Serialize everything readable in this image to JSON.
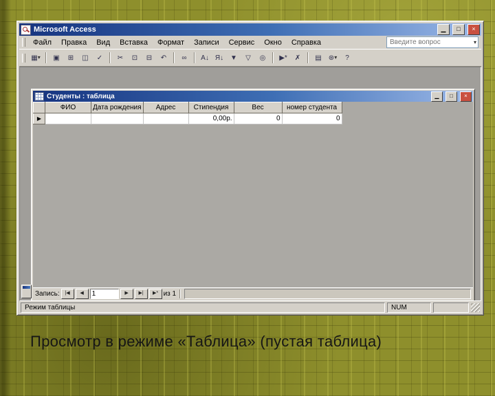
{
  "slide": {
    "caption": "Просмотр в режиме «Таблица» (пустая таблица)"
  },
  "app": {
    "title": "Microsoft Access",
    "window_buttons": {
      "minimize": "▁",
      "maximize": "□",
      "close": "×"
    },
    "caret": "▾",
    "menu": [
      "Файл",
      "Правка",
      "Вид",
      "Вставка",
      "Формат",
      "Записи",
      "Сервис",
      "Окно",
      "Справка"
    ],
    "ask_placeholder": "Введите вопрос",
    "toolbar": [
      {
        "name": "view-table",
        "glyph": "▦"
      },
      {
        "name": "save",
        "glyph": "▣"
      },
      {
        "name": "print",
        "glyph": "⊞"
      },
      {
        "name": "print-preview",
        "glyph": "◫"
      },
      {
        "name": "spelling",
        "glyph": "✓"
      },
      {
        "name": "cut",
        "glyph": "✂"
      },
      {
        "name": "copy",
        "glyph": "⊡"
      },
      {
        "name": "paste",
        "glyph": "⊟"
      },
      {
        "name": "undo",
        "glyph": "↶"
      },
      {
        "name": "insert-hyperlink",
        "glyph": "∞"
      },
      {
        "name": "sort-ascending",
        "glyph": "А↓"
      },
      {
        "name": "sort-descending",
        "glyph": "Я↓"
      },
      {
        "name": "filter-by-selection",
        "glyph": "▼"
      },
      {
        "name": "apply-filter",
        "glyph": "▽"
      },
      {
        "name": "find",
        "glyph": "◎"
      },
      {
        "name": "new-record",
        "glyph": "▶*"
      },
      {
        "name": "delete-record",
        "glyph": "✗"
      },
      {
        "name": "database-window",
        "glyph": "▤"
      },
      {
        "name": "new-object",
        "glyph": "⊛"
      },
      {
        "name": "help",
        "glyph": "?"
      }
    ],
    "status": {
      "mode": "Режим таблицы",
      "num": "NUM"
    }
  },
  "table_window": {
    "title": "Студенты : таблица",
    "window_buttons": {
      "minimize": "▁",
      "maximize": "□",
      "close": "×"
    },
    "columns": [
      "ФИО",
      "Дата рождения",
      "Адрес",
      "Стипендия",
      "Вес",
      "номер студента"
    ],
    "row": [
      "",
      "",
      "",
      "0,00р.",
      "0",
      "0"
    ],
    "record_marker": "▶",
    "nav": {
      "label": "Запись:",
      "first": "|◀",
      "prev": "◀",
      "value": "1",
      "next": "▶",
      "last": "▶|",
      "new": "▶*",
      "count": "из 1"
    }
  }
}
